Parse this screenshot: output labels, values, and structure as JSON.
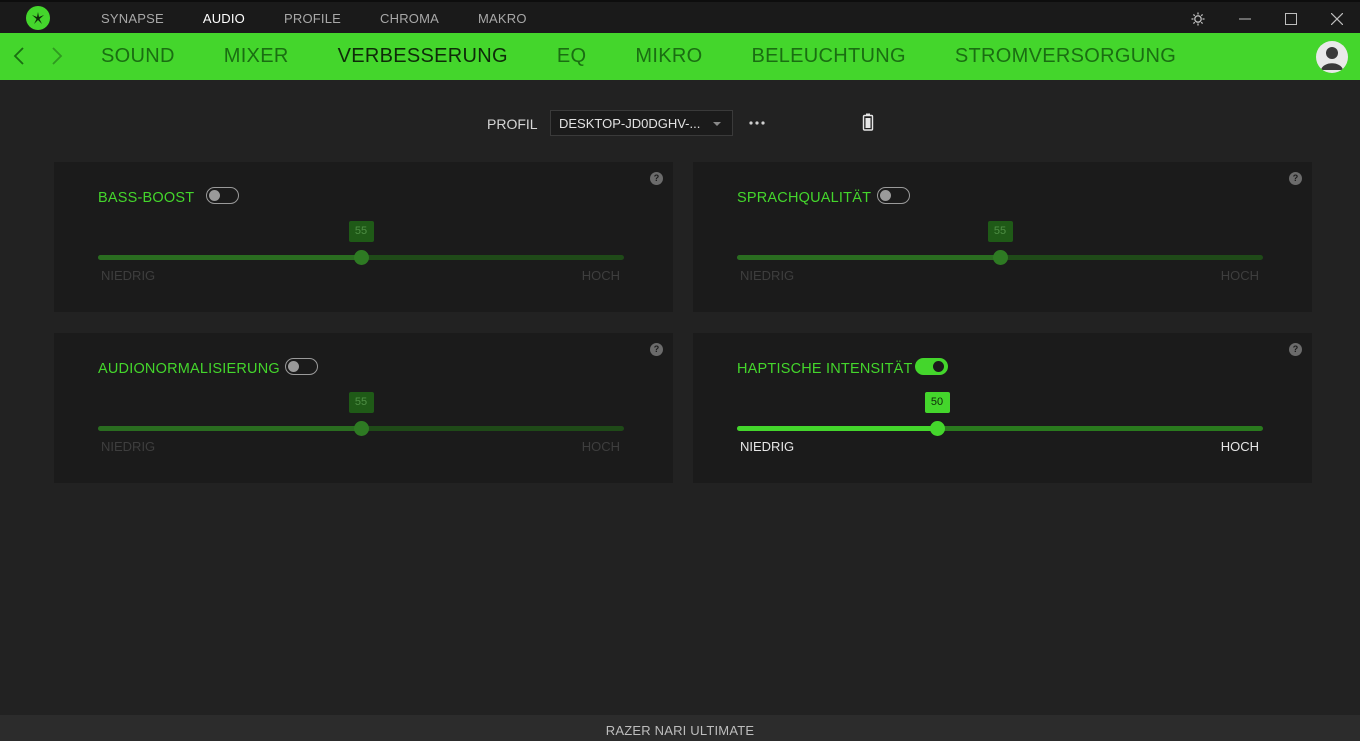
{
  "topnav": {
    "items": [
      "SYNAPSE",
      "AUDIO",
      "PROFILE",
      "CHROMA",
      "MAKRO"
    ],
    "active": "AUDIO"
  },
  "subnav": {
    "items": [
      "SOUND",
      "MIXER",
      "VERBESSERUNG",
      "EQ",
      "MIKRO",
      "BELEUCHTUNG",
      "STROMVERSORGUNG"
    ],
    "active": "VERBESSERUNG"
  },
  "profile": {
    "label": "PROFIL",
    "selected": "DESKTOP-JD0DGHV-..."
  },
  "cards": [
    {
      "title": "BASS-BOOST",
      "enabled": false,
      "value": "55",
      "level": 0.5,
      "low": "NIEDRIG",
      "high": "HOCH"
    },
    {
      "title": "SPRACHQUALITÄT",
      "enabled": false,
      "value": "55",
      "level": 0.5,
      "low": "NIEDRIG",
      "high": "HOCH"
    },
    {
      "title": "AUDIONORMALISIERUNG",
      "enabled": false,
      "value": "55",
      "level": 0.5,
      "low": "NIEDRIG",
      "high": "HOCH"
    },
    {
      "title": "HAPTISCHE INTENSITÄT",
      "enabled": true,
      "value": "50",
      "level": 0.38,
      "low": "NIEDRIG",
      "high": "HOCH"
    }
  ],
  "help_glyph": "?",
  "footer": {
    "device": "RAZER NARI ULTIMATE"
  },
  "colors": {
    "accent": "#44d62c",
    "background": "#222222",
    "card": "#1b1b1b"
  },
  "icons": [
    "razer-logo-icon",
    "settings-icon",
    "minimize-icon",
    "maximize-icon",
    "close-icon",
    "back-icon",
    "forward-icon",
    "user-icon",
    "more-icon",
    "battery-icon",
    "help-icon",
    "dropdown-caret-icon"
  ]
}
